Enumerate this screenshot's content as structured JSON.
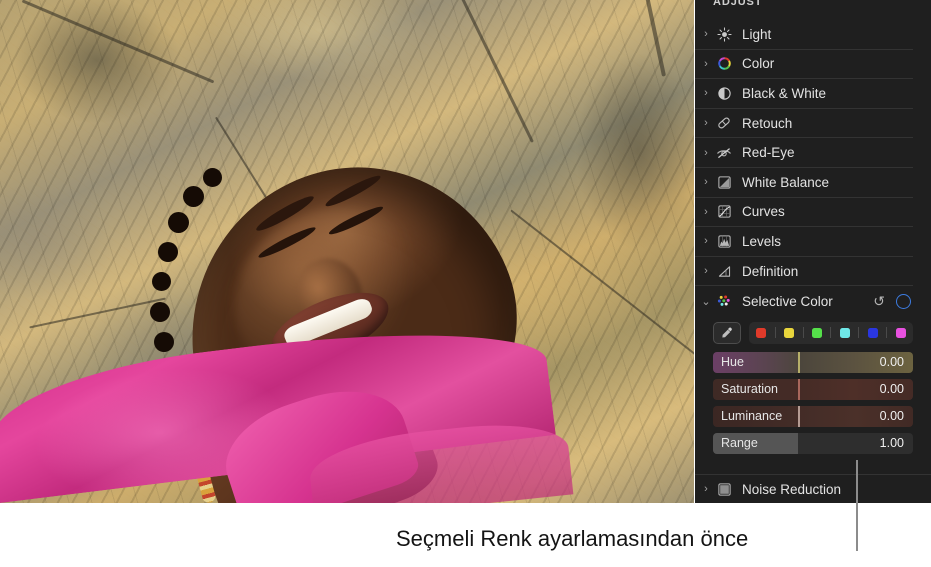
{
  "photo": {
    "alt_description": "Smiling woman with braided hair lying against a sunlit golden rock wearing a pink sheer blouse"
  },
  "panel": {
    "section_title": "ADJUST",
    "items": [
      {
        "label": "Light",
        "icon": "sun-icon",
        "disclosure": "collapsed"
      },
      {
        "label": "Color",
        "icon": "color-wheel-icon",
        "disclosure": "collapsed"
      },
      {
        "label": "Black & White",
        "icon": "half-circle-icon",
        "disclosure": "collapsed"
      },
      {
        "label": "Retouch",
        "icon": "bandage-icon",
        "disclosure": "collapsed"
      },
      {
        "label": "Red-Eye",
        "icon": "crossed-eye-icon",
        "disclosure": "collapsed"
      },
      {
        "label": "White Balance",
        "icon": "white-balance-icon",
        "disclosure": "collapsed"
      },
      {
        "label": "Curves",
        "icon": "curves-icon",
        "disclosure": "collapsed"
      },
      {
        "label": "Levels",
        "icon": "levels-icon",
        "disclosure": "collapsed"
      },
      {
        "label": "Definition",
        "icon": "definition-icon",
        "disclosure": "collapsed"
      }
    ],
    "selective_color": {
      "label": "Selective Color",
      "icon": "selective-color-dots-icon",
      "disclosure": "expanded",
      "reset_icon": "reset-arrow-icon",
      "toggle_icon": "circle-toggle-icon",
      "toggle_color": "#3d7ce0",
      "eyedropper_icon": "eyedropper-icon",
      "swatches": [
        {
          "name": "red",
          "color": "#e03a2a"
        },
        {
          "name": "yellow",
          "color": "#e8d53c"
        },
        {
          "name": "green",
          "color": "#55e04a"
        },
        {
          "name": "cyan",
          "color": "#6fe8e8"
        },
        {
          "name": "blue",
          "color": "#2a36e0"
        },
        {
          "name": "magenta",
          "color": "#e851e0"
        }
      ],
      "sliders": [
        {
          "name": "Hue",
          "value": "0.00",
          "position_pct": 42.5
        },
        {
          "name": "Saturation",
          "value": "0.00",
          "position_pct": 42.5
        },
        {
          "name": "Luminance",
          "value": "0.00",
          "position_pct": 42.5
        },
        {
          "name": "Range",
          "value": "1.00",
          "position_pct": 42.5
        }
      ]
    },
    "noise_reduction": {
      "label": "Noise Reduction",
      "icon": "noise-reduction-icon",
      "disclosure": "collapsed"
    }
  },
  "callout": {
    "caption": "Seçmeli Renk ayarlamasından önce"
  },
  "glyphs": {
    "chevron_right": "›",
    "chevron_down": "⌄",
    "reset": "↺"
  }
}
